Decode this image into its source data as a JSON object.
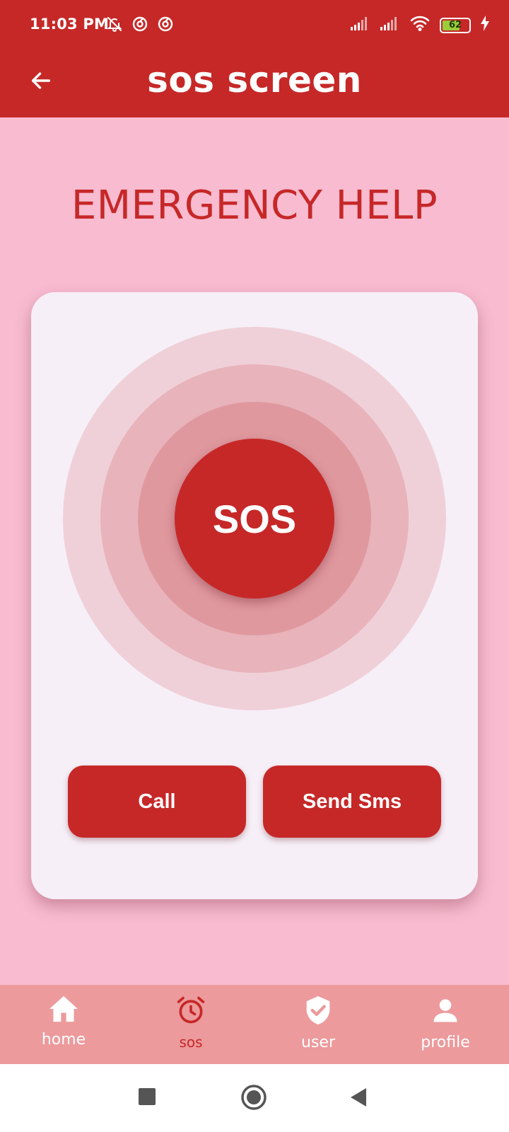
{
  "status_bar": {
    "time": "11:03 PM",
    "battery_level": "62",
    "left_icons": [
      "bell-off-icon",
      "vpn-icon",
      "vpn-icon"
    ],
    "right_icons": [
      "signal-icon",
      "signal-icon",
      "wifi-icon",
      "battery-icon",
      "charging-icon"
    ]
  },
  "app_bar": {
    "title": "sos screen",
    "back_icon": "arrow-left-icon"
  },
  "heading": "EMERGENCY HELP",
  "sos_button_label": "SOS",
  "actions": {
    "call_label": "Call",
    "sms_label": "Send Sms"
  },
  "bottom_nav": {
    "items": [
      {
        "label": "home",
        "icon": "home-icon",
        "active": false
      },
      {
        "label": "sos",
        "icon": "alarm-clock-icon",
        "active": true
      },
      {
        "label": "user",
        "icon": "shield-check-icon",
        "active": false
      },
      {
        "label": "profile",
        "icon": "person-icon",
        "active": false
      }
    ]
  },
  "colors": {
    "primary": "#c62828",
    "background": "#f8bbd0",
    "card": "#f6eff7",
    "nav_background": "#ec9a9c"
  }
}
